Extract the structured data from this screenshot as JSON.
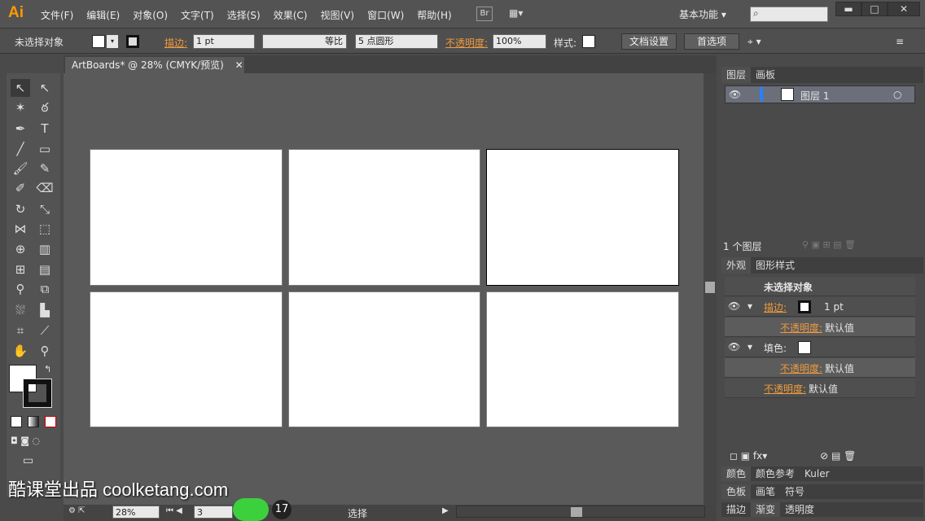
{
  "app": {
    "logo": "Ai",
    "menus": [
      "文件(F)",
      "编辑(E)",
      "对象(O)",
      "文字(T)",
      "选择(S)",
      "效果(C)",
      "视图(V)",
      "窗口(W)",
      "帮助(H)"
    ],
    "bridge": "Br",
    "workspace": "基本功能 ▾"
  },
  "control": {
    "selection": "未选择对象",
    "stroke_label": "描边:",
    "stroke_value": "1 pt",
    "stroke_profile": "等比",
    "brush": "5 点圆形",
    "opacity_label": "不透明度:",
    "opacity_value": "100%",
    "style_label": "样式:",
    "doc_setup": "文档设置",
    "prefs": "首选项"
  },
  "document": {
    "tab": "ArtBoards* @ 28% (CMYK/预览)"
  },
  "status": {
    "zoom": "28%",
    "artboard": "3",
    "tool": "选择"
  },
  "layers": {
    "tabs": [
      "图层",
      "画板"
    ],
    "layer_name": "图层 1",
    "count": "1 个图层"
  },
  "appearance": {
    "tabs": [
      "外观",
      "图形样式"
    ],
    "title": "未选择对象",
    "stroke_label": "描边:",
    "stroke_value": "1 pt",
    "opacity_label": "不透明度:",
    "default": "默认值",
    "fill_label": "填色:"
  },
  "bottom_panels": {
    "row1": [
      "颜色",
      "颜色参考",
      "Kuler"
    ],
    "row2": [
      "色板",
      "画笔",
      "符号"
    ],
    "row3": [
      "描边",
      "渐变",
      "透明度"
    ]
  },
  "watermark": "酷课堂出品 coolketang.com",
  "step": "17"
}
